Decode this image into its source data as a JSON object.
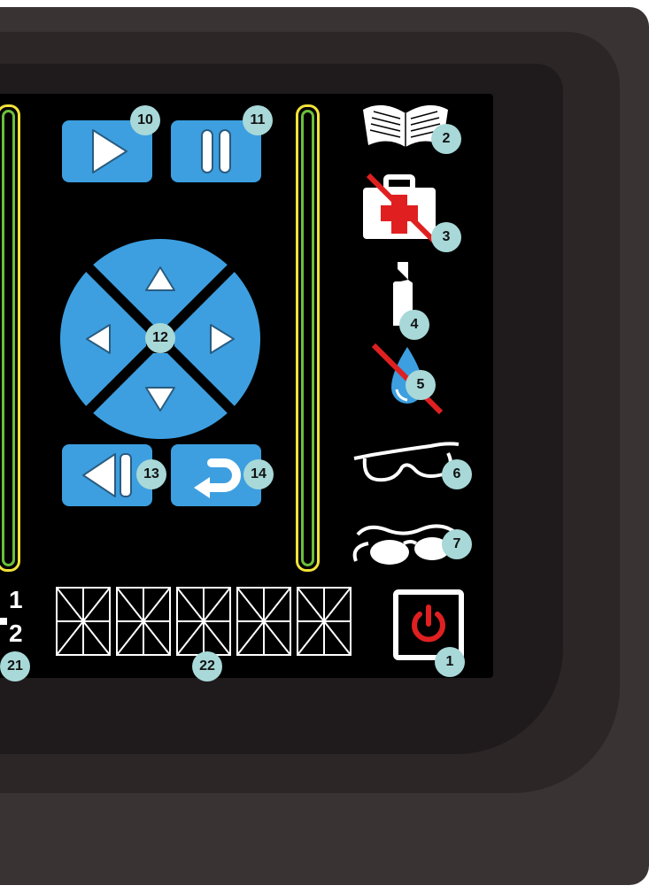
{
  "colors": {
    "button_blue": "#3d9fe0",
    "bar_yellow": "#f2e23a",
    "bar_green": "#6bbf3b",
    "callout_bg": "#a8d8d8",
    "power_red": "#e02020"
  },
  "callouts": {
    "c1": "1",
    "c2": "2",
    "c3": "3",
    "c4": "4",
    "c5": "5",
    "c6": "6",
    "c7": "7",
    "c10": "10",
    "c11": "11",
    "c12": "12",
    "c13": "13",
    "c14": "14",
    "c21": "21",
    "c22": "22"
  },
  "fraction": {
    "top": "1",
    "bottom": "2"
  },
  "icons": {
    "manual": "open-book-icon",
    "first_aid": "no-first-aid-icon",
    "bottle": "bottle-icon",
    "drop": "no-water-drop-icon",
    "glasses": "safety-glasses-icon",
    "goggles": "goggles-icon",
    "power": "power-icon"
  }
}
